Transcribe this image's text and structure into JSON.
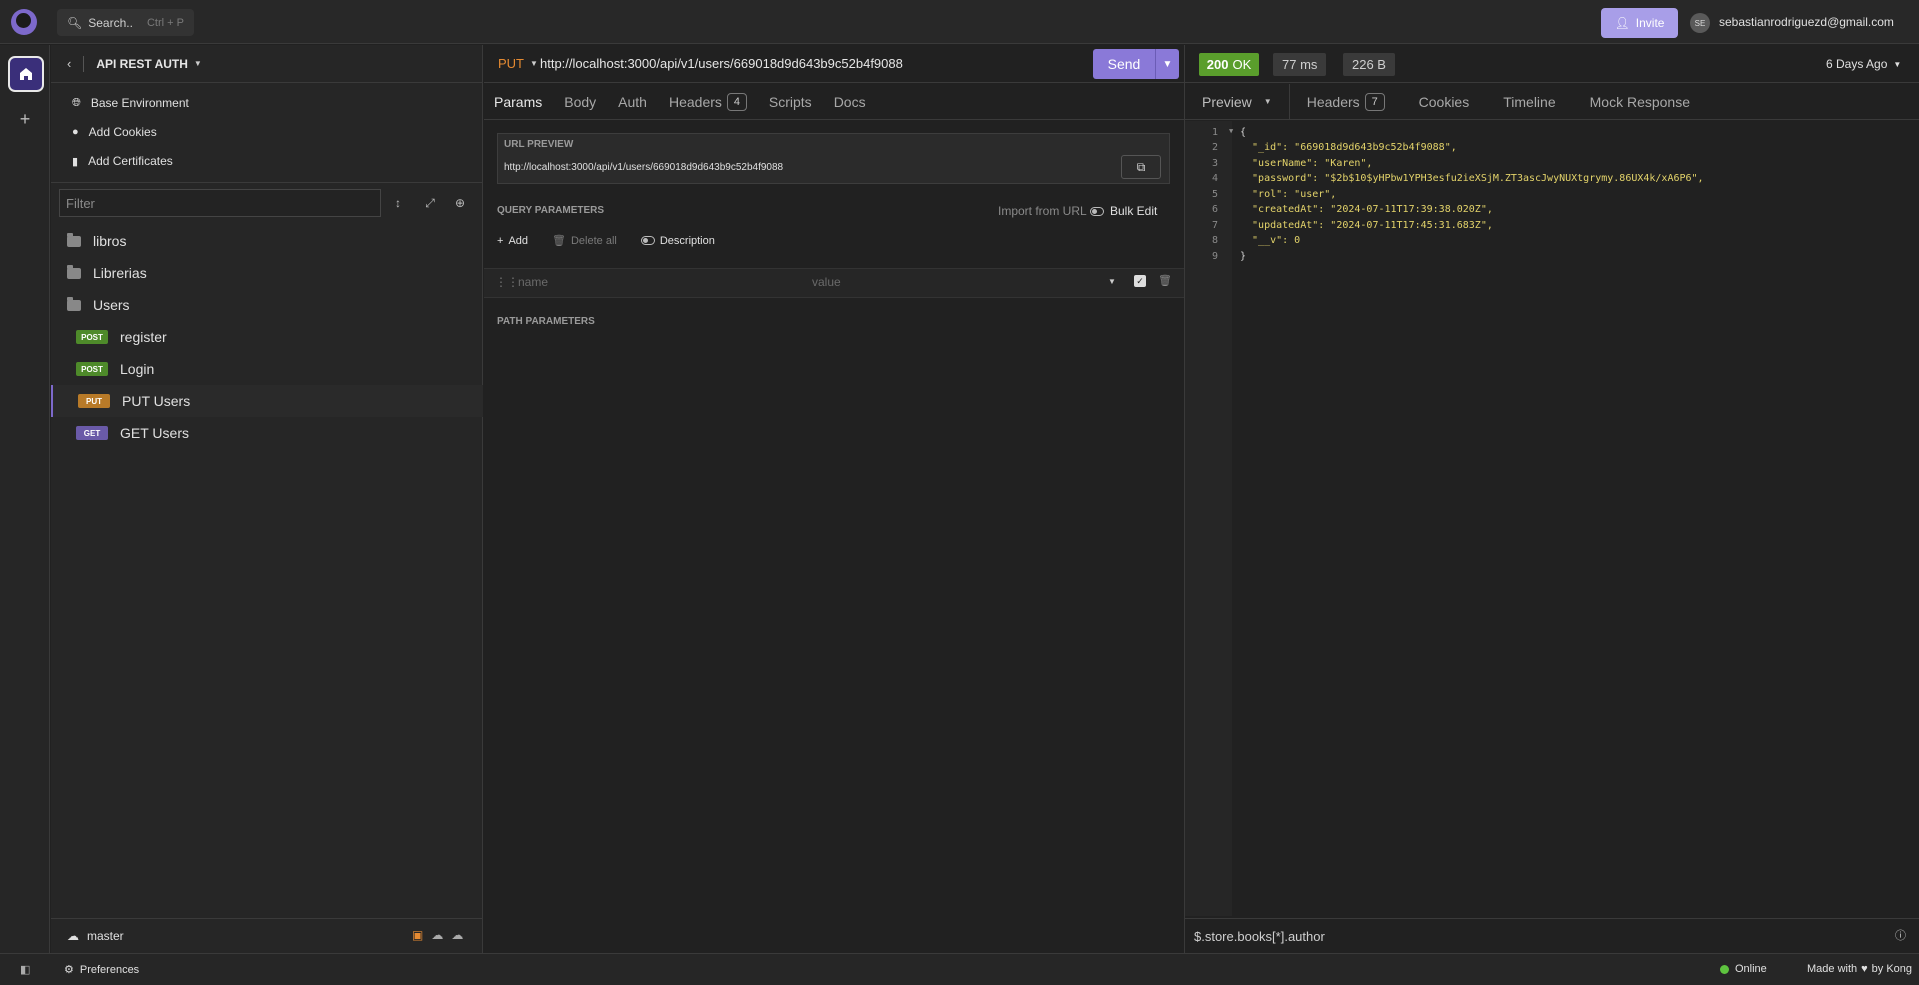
{
  "topbar": {
    "search_label": "Search..",
    "search_shortcut": "Ctrl + P",
    "invite_label": "Invite",
    "avatar_initials": "SE",
    "user_email": "sebastianrodriguezd@gmail.com"
  },
  "sidebar": {
    "collection_name": "API REST AUTH",
    "env_items": [
      "Base Environment",
      "Add Cookies",
      "Add Certificates"
    ],
    "filter_placeholder": "Filter",
    "tree": [
      {
        "type": "folder",
        "label": "libros"
      },
      {
        "type": "folder",
        "label": "Librerias"
      },
      {
        "type": "folder-open",
        "label": "Users"
      },
      {
        "type": "request",
        "method": "POST",
        "label": "register"
      },
      {
        "type": "request",
        "method": "POST",
        "label": "Login"
      },
      {
        "type": "request",
        "method": "PUT",
        "label": "PUT Users",
        "active": true
      },
      {
        "type": "request",
        "method": "GET",
        "label": "GET Users"
      }
    ],
    "branch": "master"
  },
  "request": {
    "method": "PUT",
    "url": "http://localhost:3000/api/v1/users/669018d9d643b9c52b4f9088",
    "send_label": "Send",
    "tabs": [
      "Params",
      "Body",
      "Auth",
      "Headers",
      "Scripts",
      "Docs"
    ],
    "headers_count": "4",
    "url_preview_label": "URL PREVIEW",
    "url_preview_value": "http://localhost:3000/api/v1/users/669018d9d643b9c52b4f9088",
    "query_params_label": "QUERY PARAMETERS",
    "import_from_url": "Import from URL",
    "bulk_edit": "Bulk Edit",
    "add_label": "Add",
    "delete_all_label": "Delete all",
    "description_label": "Description",
    "param_name_placeholder": "name",
    "param_value_placeholder": "value",
    "path_params_label": "PATH PARAMETERS"
  },
  "response": {
    "status_code": "200",
    "status_text": "OK",
    "time": "77 ms",
    "size": "226 B",
    "age": "6 Days Ago",
    "tabs": [
      "Preview",
      "Headers",
      "Cookies",
      "Timeline",
      "Mock Response"
    ],
    "headers_count": "7",
    "body_lines": [
      "{",
      "  \"_id\": \"669018d9d643b9c52b4f9088\",",
      "  \"userName\": \"Karen\",",
      "  \"password\": \"$2b$10$yHPbw1YPH3esfu2ieXSjM.ZT3ascJwyNUXtgrymy.86UX4k/xA6P6\",",
      "  \"rol\": \"user\",",
      "  \"createdAt\": \"2024-07-11T17:39:38.020Z\",",
      "  \"updatedAt\": \"2024-07-11T17:45:31.683Z\",",
      "  \"__v\": 0",
      "}"
    ],
    "jq_filter": "$.store.books[*].author"
  },
  "statusbar": {
    "preferences": "Preferences",
    "online": "Online",
    "made_with": "Made with",
    "by": "by Kong"
  },
  "colors": {
    "accent": "#7d69cb",
    "ok": "#5a9e2c",
    "put": "#e58a32"
  }
}
